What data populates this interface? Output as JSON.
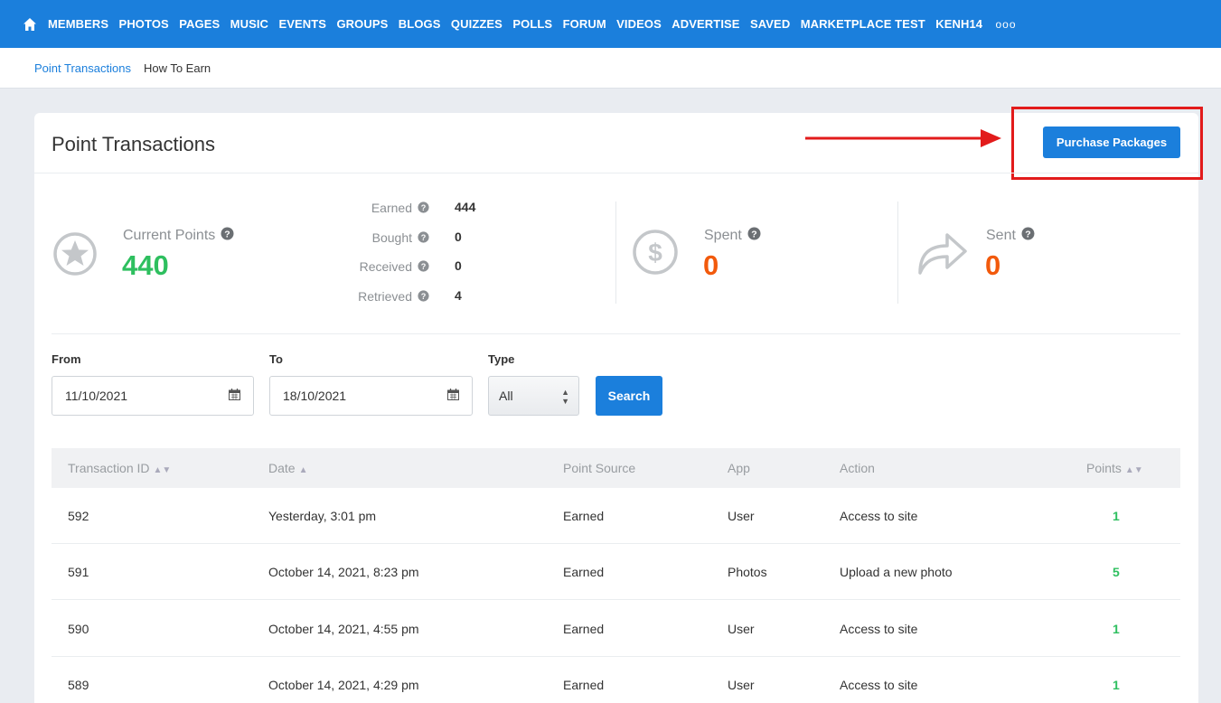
{
  "nav": {
    "items": [
      "MEMBERS",
      "PHOTOS",
      "PAGES",
      "MUSIC",
      "EVENTS",
      "GROUPS",
      "BLOGS",
      "QUIZZES",
      "POLLS",
      "FORUM",
      "VIDEOS",
      "ADVERTISE",
      "SAVED",
      "MARKETPLACE TEST",
      "KENH14"
    ],
    "more": "ooo"
  },
  "subnav": {
    "active": "Point Transactions",
    "other": "How To Earn"
  },
  "page": {
    "title": "Point Transactions",
    "purchase_label": "Purchase Packages"
  },
  "stats": {
    "current_label": "Current Points",
    "current_value": "440",
    "breakdown": [
      {
        "label": "Earned",
        "value": "444"
      },
      {
        "label": "Bought",
        "value": "0"
      },
      {
        "label": "Received",
        "value": "0"
      },
      {
        "label": "Retrieved",
        "value": "4"
      }
    ],
    "spent_label": "Spent",
    "spent_value": "0",
    "sent_label": "Sent",
    "sent_value": "0"
  },
  "filters": {
    "from_label": "From",
    "from_value": "11/10/2021",
    "to_label": "To",
    "to_value": "18/10/2021",
    "type_label": "Type",
    "type_value": "All",
    "search_label": "Search"
  },
  "table": {
    "headers": [
      "Transaction ID",
      "Date",
      "Point Source",
      "App",
      "Action",
      "Points"
    ],
    "rows": [
      [
        "592",
        "Yesterday, 3:01 pm",
        "Earned",
        "User",
        "Access to site",
        "1"
      ],
      [
        "591",
        "October 14, 2021, 8:23 pm",
        "Earned",
        "Photos",
        "Upload a new photo",
        "5"
      ],
      [
        "590",
        "October 14, 2021, 4:55 pm",
        "Earned",
        "User",
        "Access to site",
        "1"
      ],
      [
        "589",
        "October 14, 2021, 4:29 pm",
        "Earned",
        "User",
        "Access to site",
        "1"
      ]
    ]
  },
  "colors": {
    "brand": "#1b7fdc",
    "green": "#2ebf5f",
    "orange": "#f25a0c",
    "highlight": "#e21b1b"
  }
}
